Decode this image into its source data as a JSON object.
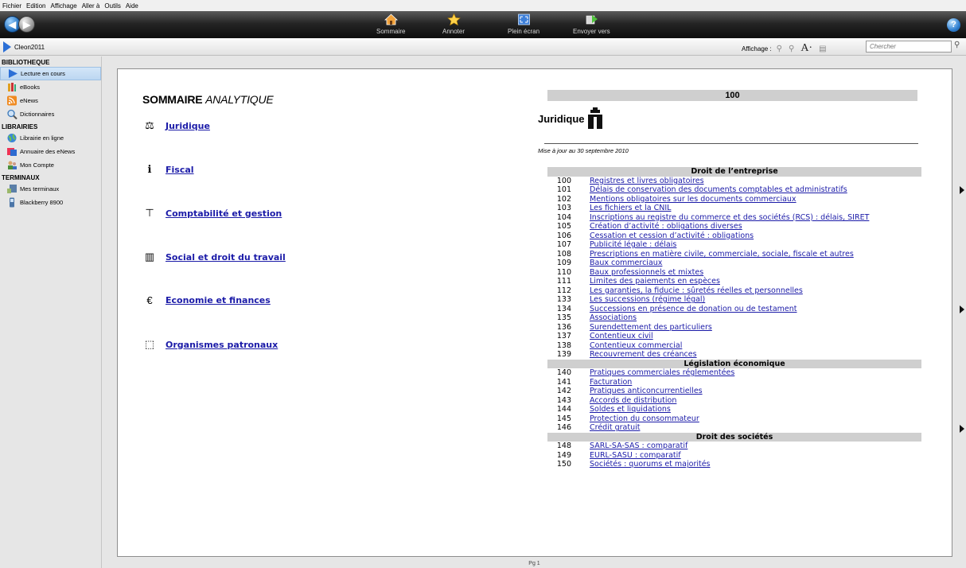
{
  "menubar": {
    "items": [
      "Fichier",
      "Edition",
      "Affichage",
      "Aller à",
      "Outils",
      "Aide"
    ]
  },
  "toolbar": {
    "tools": [
      {
        "label": "Sommaire",
        "icon": "home-icon"
      },
      {
        "label": "Annoter",
        "icon": "star-icon"
      },
      {
        "label": "Plein écran",
        "icon": "fullscreen-icon"
      },
      {
        "label": "Envoyer vers",
        "icon": "send-icon"
      }
    ],
    "help_glyph": "?"
  },
  "locbar": {
    "crumb": "Cleon2011",
    "display_label": "Affichage :",
    "search_placeholder": "Chercher"
  },
  "sidebar": {
    "sections": [
      {
        "title": "BIBLIOTHEQUE",
        "items": [
          {
            "label": "Lecture en cours",
            "icon": "play-icon",
            "selected": true
          },
          {
            "label": "eBooks",
            "icon": "books-icon"
          },
          {
            "label": "eNews",
            "icon": "rss-icon"
          },
          {
            "label": "Dictionnaires",
            "icon": "magnifier-icon"
          }
        ]
      },
      {
        "title": "LIBRAIRIES",
        "items": [
          {
            "label": "Librairie en ligne",
            "icon": "globe-icon"
          },
          {
            "label": "Annuaire des eNews",
            "icon": "directory-icon"
          },
          {
            "label": "Mon Compte",
            "icon": "account-icon"
          }
        ]
      },
      {
        "title": "TERMINAUX",
        "items": [
          {
            "label": "Mes terminaux",
            "icon": "devices-icon"
          },
          {
            "label": "Blackberry 8900",
            "icon": "phone-icon"
          }
        ]
      }
    ]
  },
  "page": {
    "title_bold": "SOMMAIRE",
    "title_italic": "ANALYTIQUE",
    "toc": [
      {
        "label": "Juridique",
        "symbol": "⚖"
      },
      {
        "label": "Fiscal",
        "symbol": "ℹ"
      },
      {
        "label": "Comptabilité et gestion",
        "symbol": "⊤"
      },
      {
        "label": "Social et droit du travail",
        "symbol": "▥"
      },
      {
        "label": "Economie et finances",
        "symbol": "€"
      },
      {
        "label": "Organismes patronaux",
        "symbol": "⬚"
      }
    ],
    "section_number": "100",
    "section_title": "Juridique",
    "update_note": "Mise à jour au 30 septembre 2010",
    "groups": [
      {
        "title": "Droit de l’entreprise",
        "rows": [
          {
            "n": "100",
            "t": "Registres et livres obligatoires"
          },
          {
            "n": "101",
            "t": "Délais de conservation des documents comptables et administratifs"
          },
          {
            "n": "102",
            "t": "Mentions obligatoires sur les documents commerciaux"
          },
          {
            "n": "103",
            "t": "Les fichiers et la CNIL"
          },
          {
            "n": "104",
            "t": "Inscriptions au registre du commerce et des sociétés (RCS) : délais, SIRET"
          },
          {
            "n": "105",
            "t": "Création d’activité : obligations diverses"
          },
          {
            "n": "106",
            "t": "Cessation et cession d’activité : obligations"
          },
          {
            "n": "107",
            "t": "Publicité légale : délais"
          },
          {
            "n": "108",
            "t": "Prescriptions en matière civile, commerciale, sociale, fiscale et autres"
          },
          {
            "n": "109",
            "t": "Baux commerciaux"
          },
          {
            "n": "110",
            "t": "Baux professionnels et mixtes"
          },
          {
            "n": "111",
            "t": "Limites des paiements en espèces"
          },
          {
            "n": "112",
            "t": "Les garanties, la fiducie : sûretés réelles et personnelles"
          },
          {
            "n": "133",
            "t": "Les successions (régime légal)"
          },
          {
            "n": "134",
            "t": "Successions en présence de donation ou de testament"
          },
          {
            "n": "135",
            "t": "Associations"
          },
          {
            "n": "136",
            "t": "Surendettement des particuliers"
          },
          {
            "n": "137",
            "t": "Contentieux civil"
          },
          {
            "n": "138",
            "t": "Contentieux commercial"
          },
          {
            "n": "139",
            "t": "Recouvrement des créances"
          }
        ]
      },
      {
        "title": "Législation économique",
        "rows": [
          {
            "n": "140",
            "t": "Pratiques commerciales réglementées"
          },
          {
            "n": "141",
            "t": "Facturation"
          },
          {
            "n": "142",
            "t": "Pratiques anticoncurrentielles"
          },
          {
            "n": "143",
            "t": "Accords de distribution"
          },
          {
            "n": "144",
            "t": "Soldes et liquidations"
          },
          {
            "n": "145",
            "t": "Protection du consommateur"
          },
          {
            "n": "146",
            "t": "Crédit gratuit"
          }
        ]
      },
      {
        "title": "Droit des sociétés",
        "rows": [
          {
            "n": "148",
            "t": "SARL-SA-SAS : comparatif"
          },
          {
            "n": "149",
            "t": "EURL-SASU : comparatif"
          },
          {
            "n": "150",
            "t": "Sociétés : quorums et majorités"
          }
        ]
      }
    ]
  },
  "status": {
    "page_indicator": "Pg 1"
  },
  "colors": {
    "link": "#1b1ba8",
    "group_bg": "#cfcfcf",
    "selected_bg": "#bcd7f1"
  }
}
